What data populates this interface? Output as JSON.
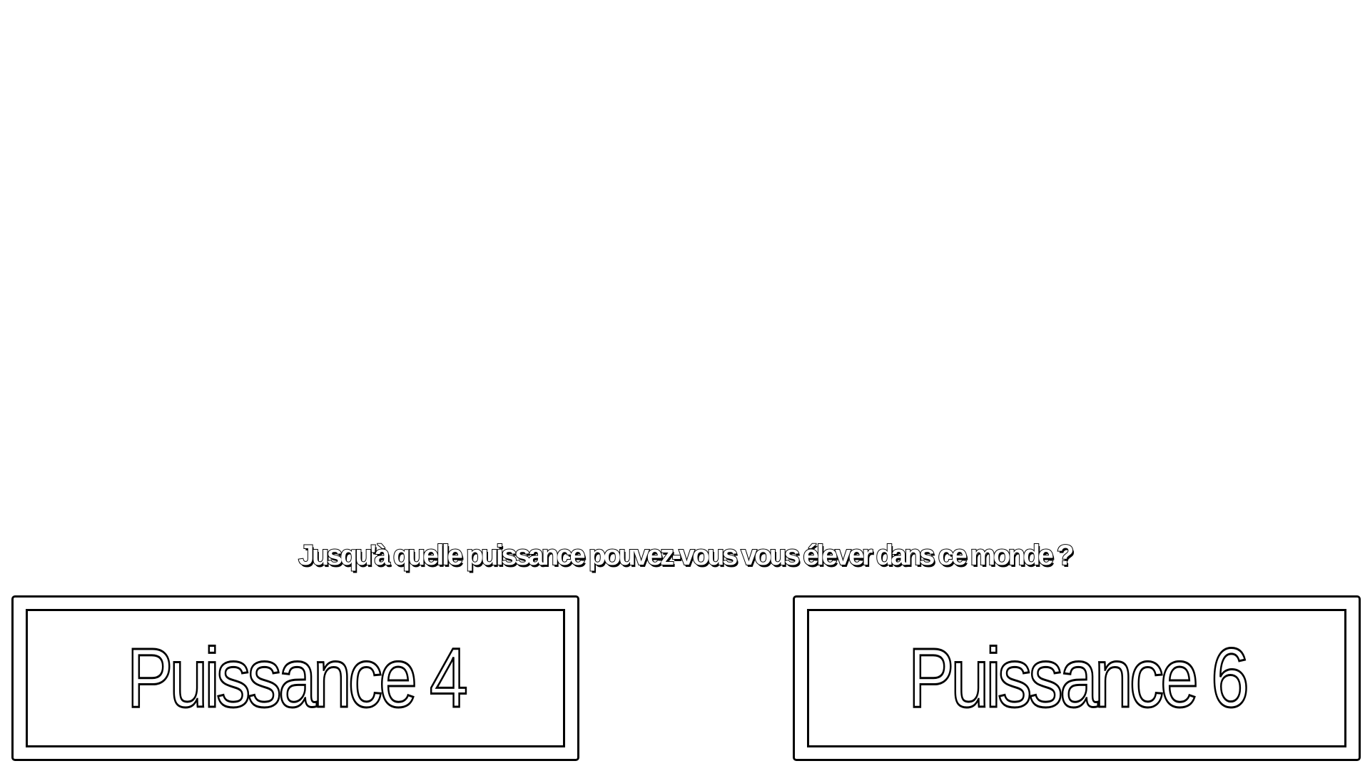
{
  "question": "Jusqu'à quelle puissance pouvez-vous vous élever dans ce monde ?",
  "choices": [
    {
      "label": "Puissance 4"
    },
    {
      "label": "Puissance 6"
    }
  ],
  "colors": {
    "background": "#ffffff",
    "outline": "#000000",
    "text_fill": "#ffffff"
  }
}
